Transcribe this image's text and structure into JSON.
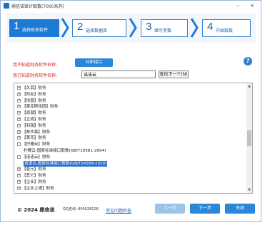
{
  "window": {
    "title": "鼎信诺审计取数(7000系列)"
  },
  "steps": [
    {
      "num": "1",
      "label": "选择财务软件"
    },
    {
      "num": "2",
      "label": "选择数据库"
    },
    {
      "num": "3",
      "label": "填写参数"
    },
    {
      "num": "4",
      "label": "开始取数"
    }
  ],
  "unknown_label": "我不知道财务软件名称:",
  "analyze_button": "分析接口",
  "known_label": "我已知道财务软件名称:",
  "search": {
    "value": "诺诺云"
  },
  "find_next": "查找下一个(N)",
  "tree": [
    {
      "exp": "+",
      "text": "【久其】财务",
      "level": 0
    },
    {
      "exp": "+",
      "text": "【科友】财务",
      "level": 0
    },
    {
      "exp": "+",
      "text": "【快普】财务",
      "level": 0
    },
    {
      "exp": "+",
      "text": "【莱克斯佳团】财务",
      "level": 0
    },
    {
      "exp": "+",
      "text": "【浪潮】财务",
      "level": 0
    },
    {
      "exp": "+",
      "text": "【立成】财务",
      "level": 0
    },
    {
      "exp": "+",
      "text": "【利瑞】财务",
      "level": 0
    },
    {
      "exp": "+",
      "text": "【林木森】财务",
      "level": 0
    },
    {
      "exp": "+",
      "text": "【莱克】财务",
      "level": 0
    },
    {
      "exp": "-",
      "text": "【柠檬云】财务",
      "level": 0
    },
    {
      "exp": "",
      "text": "柠檬云-国家标准接口取数(GB/T19581-2004)",
      "level": 1
    },
    {
      "exp": "-",
      "text": "【诺诺云】财务",
      "level": 0
    },
    {
      "exp": "",
      "text": "诺诺云-国家标准接口取数(GB/T24589-2010)",
      "level": 1,
      "selected": true
    },
    {
      "exp": "+",
      "text": "【普元】财务",
      "level": 0
    },
    {
      "exp": "+",
      "text": "【其它】财务",
      "level": 0
    },
    {
      "exp": "+",
      "text": "【企业】财务",
      "level": 0
    },
    {
      "exp": "+",
      "text": "【企业之魂】财务",
      "level": 0
    }
  ],
  "footer": {
    "copyright": "© 2024 鼎信诺",
    "qq": "QQ咨询: 800028128",
    "tel": "",
    "faq": "常见问题检查",
    "prev": "上一步",
    "next": "下一步",
    "close": "关闭"
  }
}
